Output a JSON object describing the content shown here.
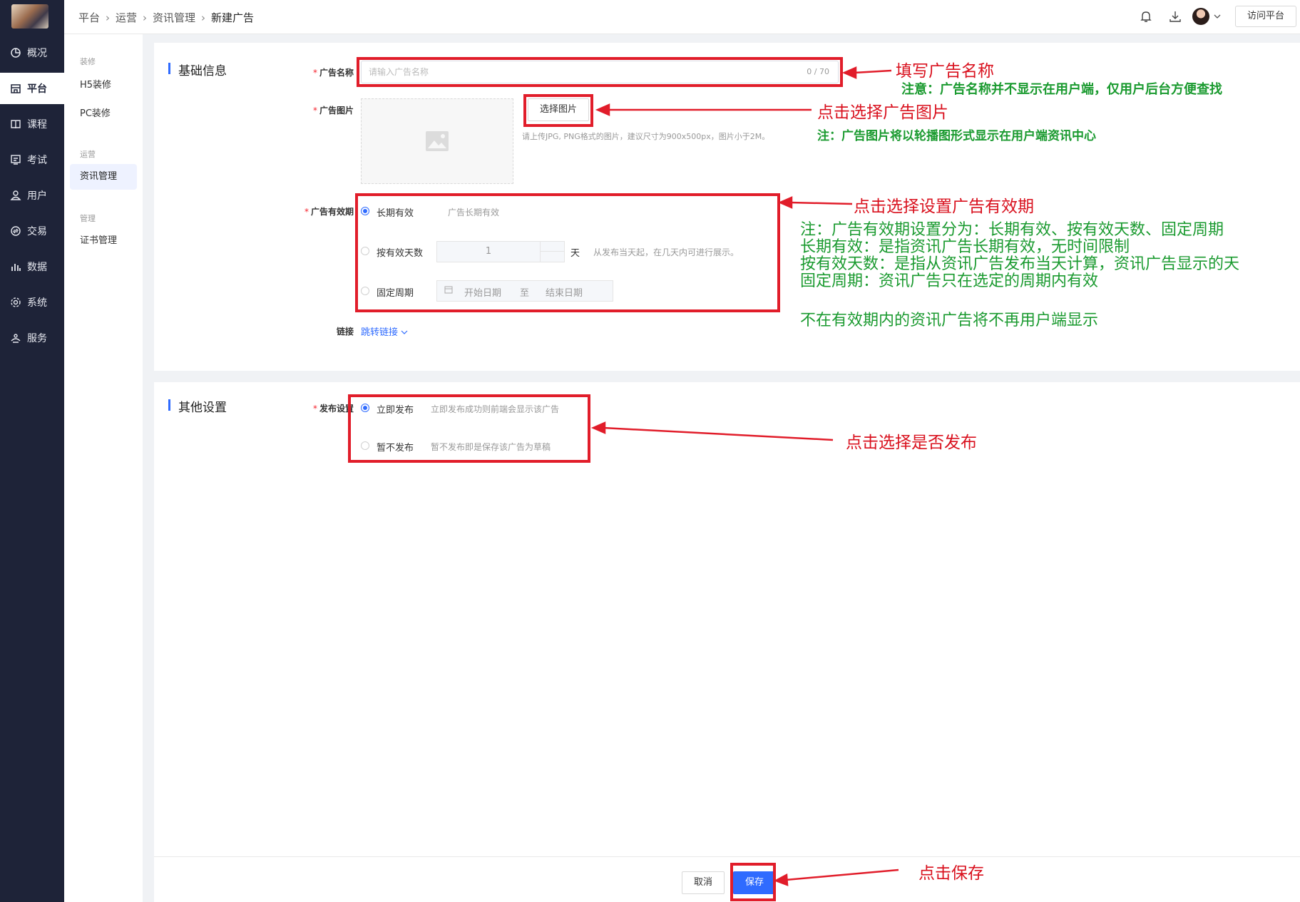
{
  "sidebar": {
    "items": [
      {
        "label": "概况",
        "icon": "pie-chart-icon"
      },
      {
        "label": "平台",
        "icon": "store-icon"
      },
      {
        "label": "课程",
        "icon": "book-icon"
      },
      {
        "label": "考试",
        "icon": "exam-icon"
      },
      {
        "label": "用户",
        "icon": "user-icon"
      },
      {
        "label": "交易",
        "icon": "exchange-icon"
      },
      {
        "label": "数据",
        "icon": "bar-chart-icon"
      },
      {
        "label": "系统",
        "icon": "gear-icon"
      },
      {
        "label": "服务",
        "icon": "service-icon"
      }
    ],
    "active_index": 1
  },
  "submenu": {
    "groups": [
      {
        "title": "装修",
        "items": [
          "H5装修",
          "PC装修"
        ]
      },
      {
        "title": "运营",
        "items": [
          "资讯管理"
        ]
      },
      {
        "title": "管理",
        "items": [
          "证书管理"
        ]
      }
    ],
    "active_item": "资讯管理"
  },
  "header": {
    "breadcrumbs": [
      "平台",
      "运营",
      "资讯管理",
      "新建广告"
    ],
    "visit_button": "访问平台"
  },
  "form": {
    "section_basic": "基础信息",
    "ad_name": {
      "label": "广告名称",
      "placeholder": "请输入广告名称",
      "count": "0 / 70"
    },
    "ad_image": {
      "label": "广告图片",
      "button": "选择图片",
      "hint": "请上传JPG, PNG格式的图片，建议尺寸为900x500px，图片小于2M。"
    },
    "validity": {
      "label": "广告有效期",
      "options": [
        {
          "label": "长期有效",
          "desc": "广告长期有效",
          "checked": true
        },
        {
          "label": "按有效天数",
          "checked": false,
          "value": "1",
          "unit": "天",
          "desc": "从发布当天起，在几天内可进行展示。"
        },
        {
          "label": "固定周期",
          "checked": false,
          "start_placeholder": "开始日期",
          "to": "至",
          "end_placeholder": "结束日期"
        }
      ]
    },
    "link": {
      "label": "链接",
      "value": "跳转链接"
    },
    "section_other": "其他设置",
    "publish": {
      "label": "发布设置",
      "options": [
        {
          "label": "立即发布",
          "desc": "立即发布成功则前端会显示该广告",
          "checked": true
        },
        {
          "label": "暂不发布",
          "desc": "暂不发布即是保存该广告为草稿",
          "checked": false
        }
      ]
    },
    "cancel_button": "取消",
    "save_button": "保存"
  },
  "annotations": {
    "fill_name": "填写广告名称",
    "fill_name_note": "注意：广告名称并不显示在用户端，仅用户后台方便查找",
    "choose_image": "点击选择广告图片",
    "choose_image_note": "注：广告图片将以轮播图形式显示在用户端资讯中心",
    "validity": "点击选择设置广告有效期",
    "validity_notes": [
      "注：广告有效期设置分为：长期有效、按有效天数、固定周期",
      "长期有效：是指资讯广告长期有效，无时间限制",
      "按有效天数：是指从资讯广告发布当天计算，资讯广告显示的天",
      "固定周期：资讯广告只在选定的周期内有效"
    ],
    "validity_note_extra": "不在有效期内的资讯广告将不再用户端显示",
    "publish": "点击选择是否发布",
    "save": "点击保存"
  },
  "colors": {
    "sidebar_bg": "#1e2338",
    "accent": "#2f6bff",
    "annotation_red": "#e11d2a",
    "annotation_green": "#1a9a2f"
  }
}
